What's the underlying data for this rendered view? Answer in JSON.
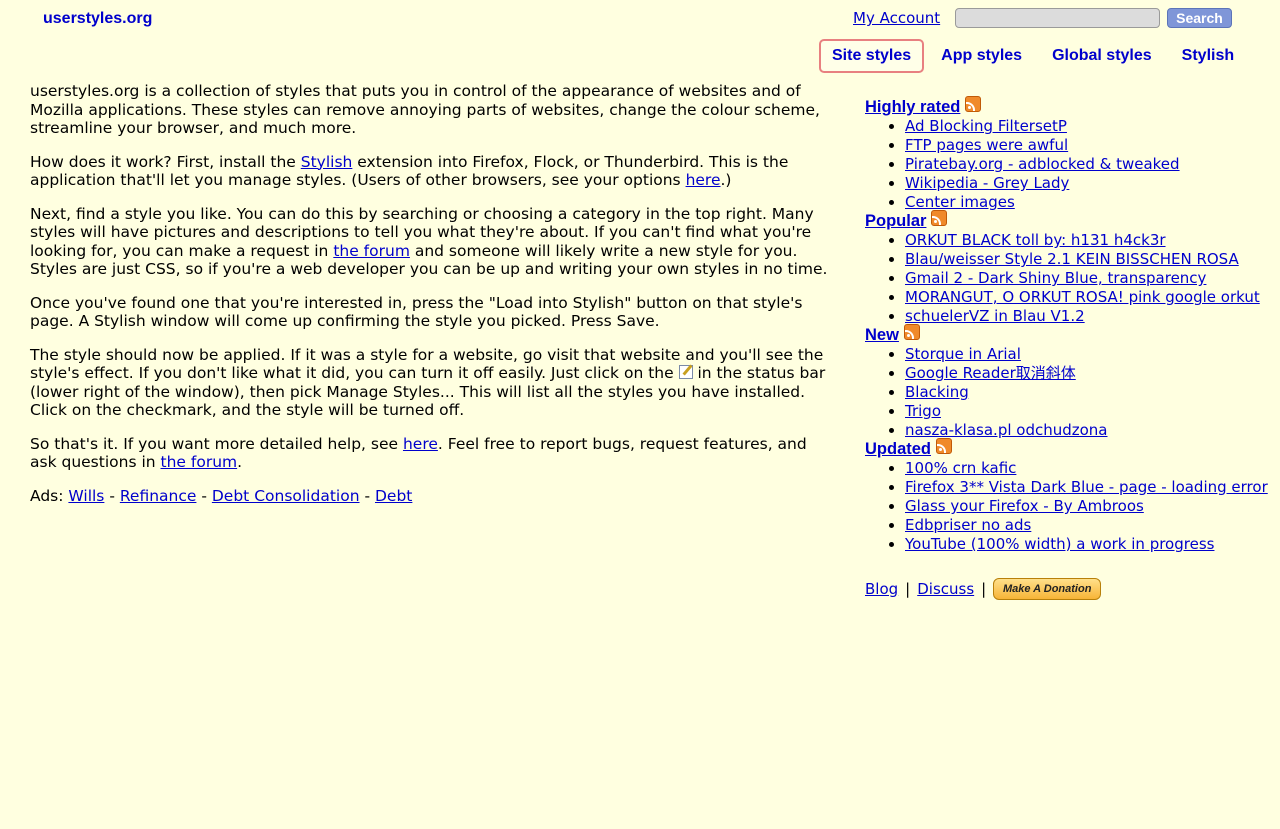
{
  "header": {
    "logo": "userstyles.org",
    "my_account": "My Account",
    "search_placeholder": "",
    "search_button": "Search"
  },
  "tabs": [
    {
      "label": "Site styles",
      "active": true
    },
    {
      "label": "App styles",
      "active": false
    },
    {
      "label": "Global styles",
      "active": false
    },
    {
      "label": "Stylish",
      "active": false
    }
  ],
  "main": {
    "p1": "userstyles.org is a collection of styles that puts you in control of the appearance of websites and of Mozilla applications. These styles can remove annoying parts of websites, change the colour scheme, streamline your browser, and much more.",
    "p2": {
      "t1": "How does it work? First, install the ",
      "link1": "Stylish",
      "t2": " extension into Firefox, Flock, or Thunderbird. This is the application that'll let you manage styles. (Users of other browsers, see your options ",
      "link2": "here",
      "t3": ".)"
    },
    "p3": {
      "t1": "Next, find a style you like. You can do this by searching or choosing a category in the top right. Many styles will have pictures and descriptions to tell you what they're about. If you can't find what you're looking for, you can make a request in ",
      "link1": "the forum",
      "t2": " and someone will likely write a new style for you. Styles are just CSS, so if you're a web developer you can be up and writing your own styles in no time."
    },
    "p4": "Once you've found one that you're interested in, press the \"Load into Stylish\" button on that style's page. A Stylish window will come up confirming the style you picked. Press Save.",
    "p5": {
      "t1": "The style should now be applied. If it was a style for a website, go visit that website and you'll see the style's effect. If you don't like what it did, you can turn it off easily. Just click on the ",
      "t2": " in the status bar (lower right of the window), then pick Manage Styles... This will list all the styles you have installed. Click on the checkmark, and the style will be turned off."
    },
    "p6": {
      "t1": "So that's it. If you want more detailed help, see ",
      "link1": "here",
      "t2": ". Feel free to report bugs, request features, and ask questions in ",
      "link2": "the forum",
      "t3": "."
    },
    "ads": {
      "label": "Ads: ",
      "links": [
        "Wills",
        "Refinance",
        "Debt Consolidation",
        "Debt"
      ],
      "sep": " - "
    }
  },
  "sidebar": {
    "sections": [
      {
        "title": "Highly rated",
        "items": [
          "Ad Blocking FiltersetP",
          "FTP pages were awful",
          "Piratebay.org - adblocked & tweaked",
          "Wikipedia - Grey Lady",
          "Center images"
        ]
      },
      {
        "title": "Popular",
        "items": [
          "ORKUT BLACK toll by: h131 h4ck3r",
          "Blau/weisser Style 2.1 KEIN BISSCHEN ROSA",
          "Gmail 2 - Dark Shiny Blue, transparency",
          "MORANGUT, O ORKUT ROSA! pink google orkut",
          "schuelerVZ in Blau V1.2"
        ]
      },
      {
        "title": "New",
        "items": [
          "Storque in Arial",
          "Google Reader取消斜体",
          "Blacking",
          "Trigo",
          "nasza-klasa.pl odchudzona"
        ]
      },
      {
        "title": "Updated",
        "items": [
          "100% crn kafic",
          "Firefox 3** Vista Dark Blue - page - loading error",
          "Glass your Firefox - By Ambroos",
          "Edbpriser no ads",
          "YouTube (100% width) a work in progress"
        ]
      }
    ],
    "footer": {
      "blog": "Blog",
      "discuss": "Discuss",
      "sep": "|",
      "donate": "Make A Donation"
    }
  }
}
